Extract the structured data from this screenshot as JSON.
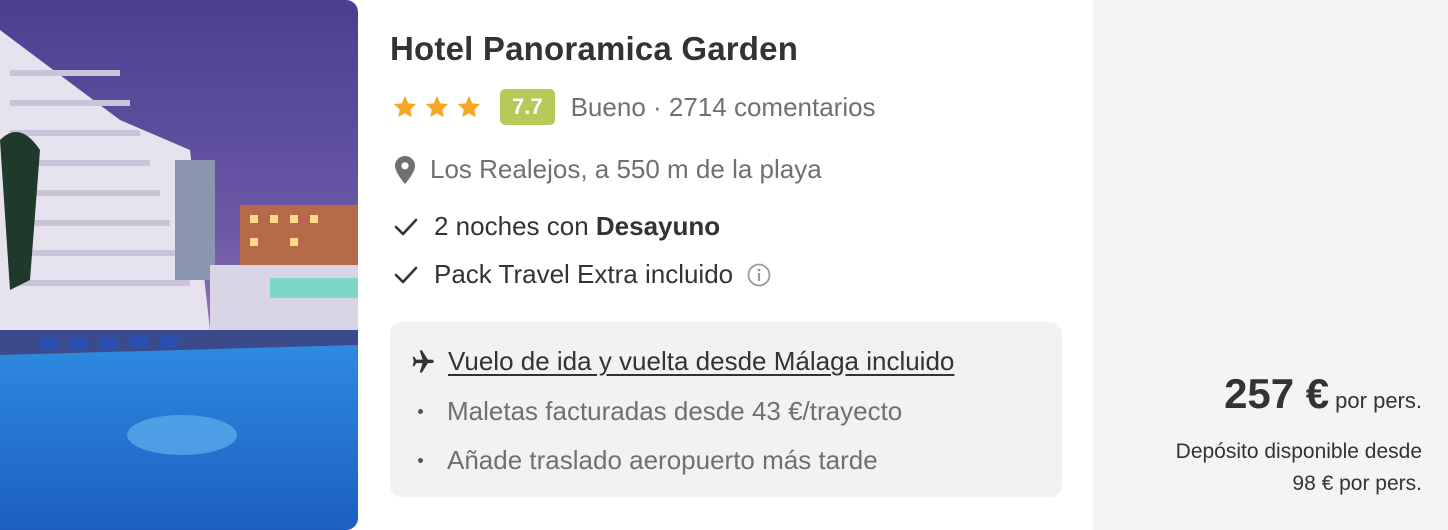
{
  "hotel": {
    "name": "Hotel Panoramica Garden",
    "stars": 3,
    "score": "7.7",
    "rating_text": "Bueno · 2714 comentarios",
    "location": "Los Realejos, a 550 m de la playa",
    "features": [
      {
        "prefix": "2 noches con ",
        "bold": "Desayuno"
      },
      {
        "prefix": "Pack Travel Extra incluido",
        "bold": ""
      }
    ]
  },
  "flight": {
    "link_text": "Vuelo de ida y vuelta desde Málaga incluido",
    "bullets": [
      "Maletas facturadas desde 43 €/trayecto",
      "Añade traslado aeropuerto más tarde"
    ]
  },
  "price": {
    "amount": "257 €",
    "suffix": "por pers.",
    "deposit_line1": "Depósito disponible desde",
    "deposit_line2": "98 € por pers."
  },
  "colors": {
    "star": "#f6a623",
    "score_badge": "#b8c95a",
    "muted_text": "#707070",
    "flight_box_bg": "#f2f2f3"
  },
  "icons": [
    "star-icon",
    "location-pin-icon",
    "check-icon",
    "info-icon",
    "plane-icon"
  ]
}
